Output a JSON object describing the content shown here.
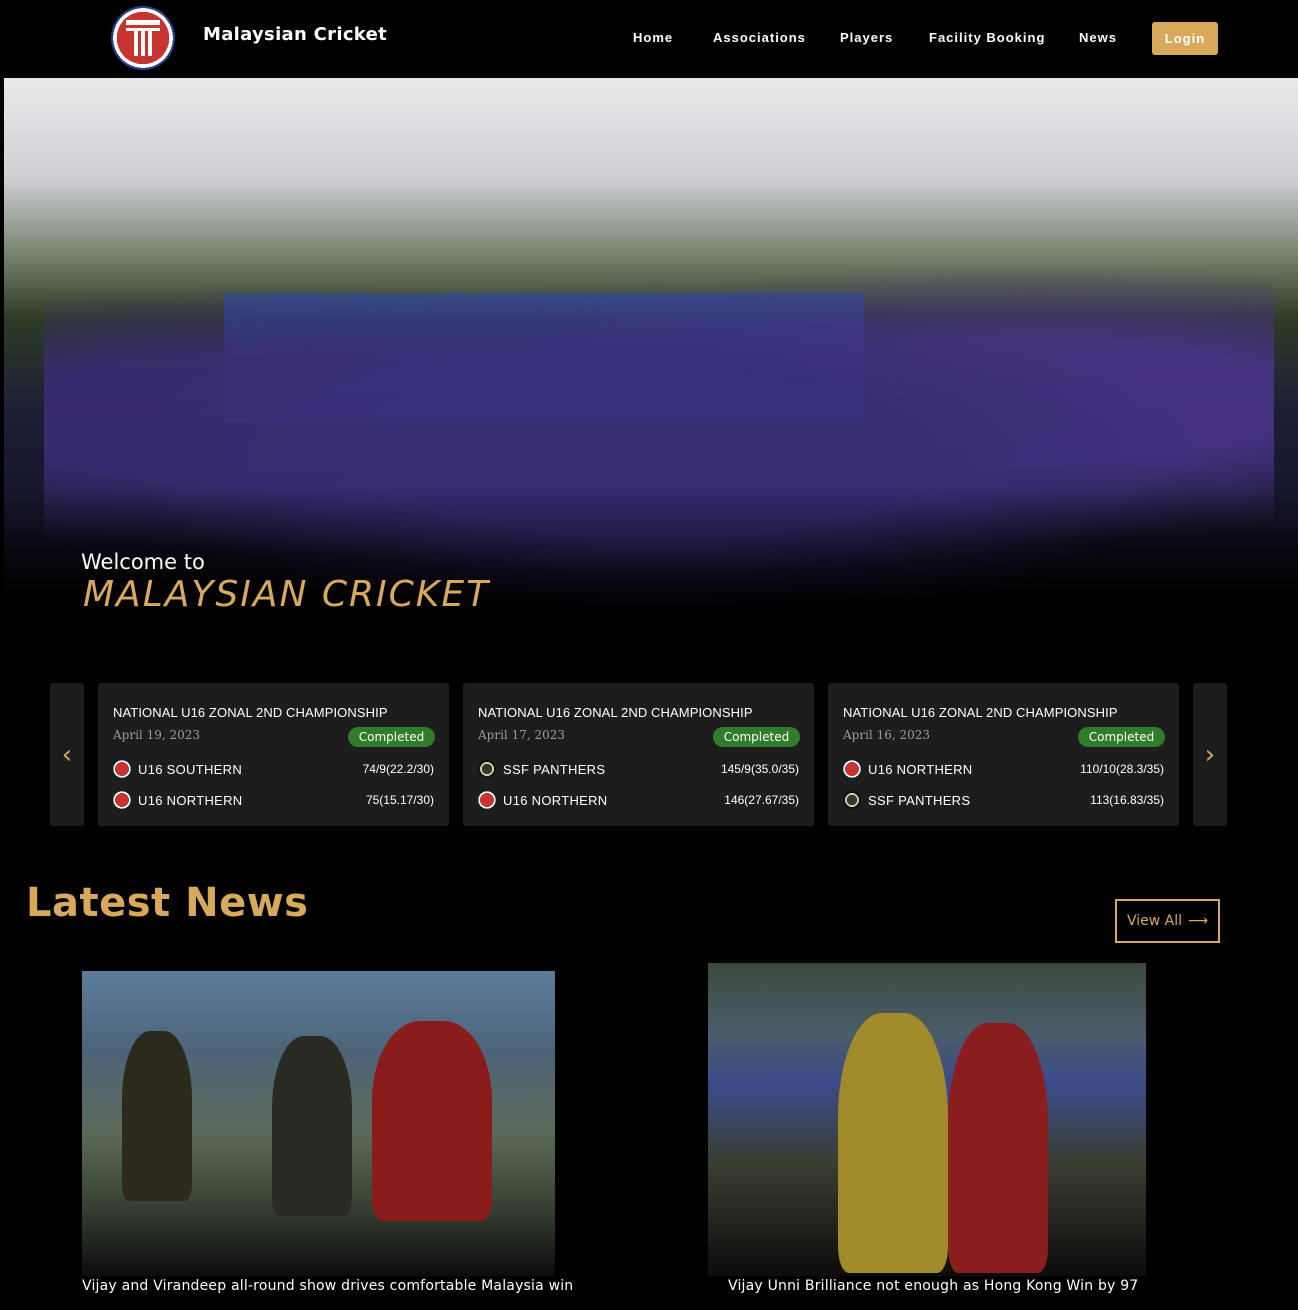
{
  "nav": {
    "brand": "Malaysian Cricket",
    "links": [
      "Home",
      "Associations",
      "Players",
      "Facility Booking",
      "News"
    ],
    "login_label": "Login"
  },
  "hero": {
    "welcome": "Welcome to",
    "title": "MALAYSIAN CRICKET"
  },
  "matches": {
    "prev_icon": "chevron-left-icon",
    "next_icon": "chevron-right-icon",
    "cards": [
      {
        "title": "NATIONAL U16 ZONAL 2ND CHAMPIONSHIP",
        "date": "April 19, 2023",
        "status": "Completed",
        "teams": [
          {
            "name": "U16 SOUTHERN",
            "score": "74/9(22.2/30)",
            "icon": "mc"
          },
          {
            "name": "U16 NORTHERN",
            "score": "75(15.17/30)",
            "icon": "mc"
          }
        ]
      },
      {
        "title": "NATIONAL U16 ZONAL 2ND CHAMPIONSHIP",
        "date": "April 17, 2023",
        "status": "Completed",
        "teams": [
          {
            "name": "SSF PANTHERS",
            "score": "145/9(35.0/35)",
            "icon": "ssf"
          },
          {
            "name": "U16 NORTHERN",
            "score": "146(27.67/35)",
            "icon": "mc"
          }
        ]
      },
      {
        "title": "NATIONAL U16 ZONAL 2ND CHAMPIONSHIP",
        "date": "April 16, 2023",
        "status": "Completed",
        "teams": [
          {
            "name": "U16 NORTHERN",
            "score": "110/10(28.3/35)",
            "icon": "mc"
          },
          {
            "name": "SSF PANTHERS",
            "score": "113(16.83/35)",
            "icon": "ssf"
          }
        ]
      }
    ]
  },
  "news": {
    "heading": "Latest News",
    "view_all": "View All",
    "items": [
      {
        "caption": "Vijay and Virandeep all-round show drives comfortable Malaysia win"
      },
      {
        "caption": "Vijay Unni Brilliance not enough as Hong Kong Win by 97"
      }
    ]
  },
  "colors": {
    "accent": "#d8a95b",
    "background": "#000000",
    "card": "#1d1d1d",
    "status_completed": "#2f7d2b"
  }
}
